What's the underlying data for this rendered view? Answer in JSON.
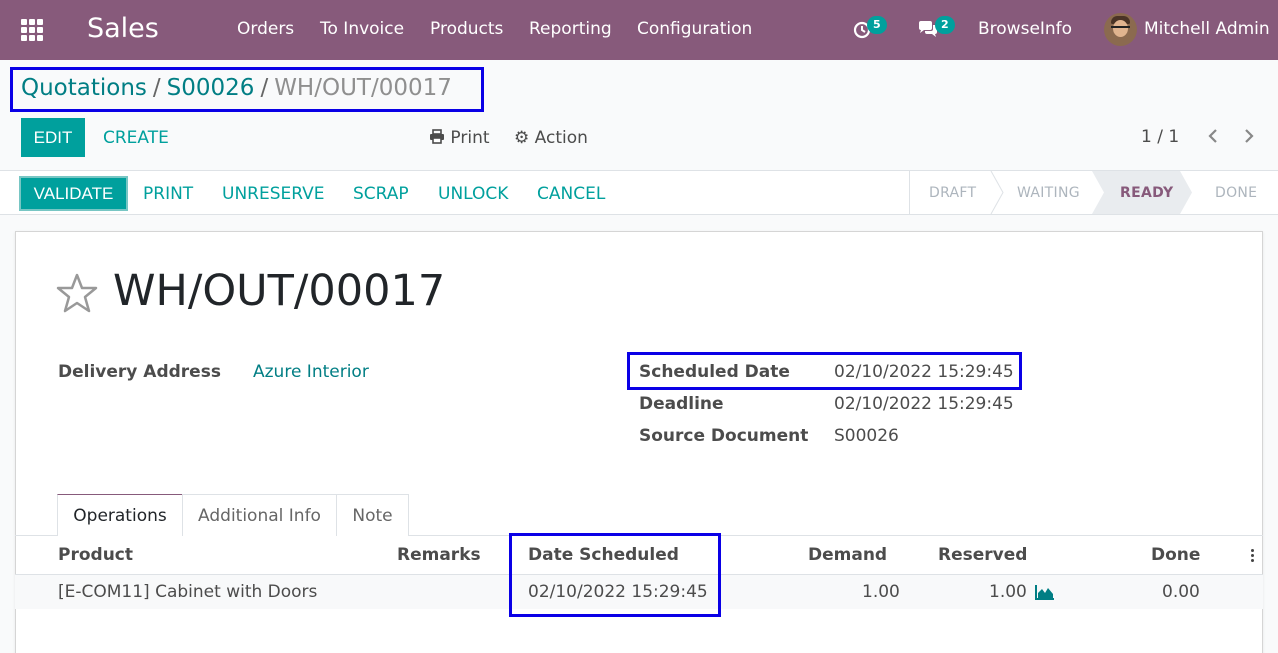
{
  "navbar": {
    "app_name": "Sales",
    "menu": [
      "Orders",
      "To Invoice",
      "Products",
      "Reporting",
      "Configuration"
    ],
    "activity_count": "5",
    "messages_count": "2",
    "company": "BrowseInfo",
    "user": "Mitchell Admin"
  },
  "breadcrumb": {
    "items": [
      "Quotations",
      "S00026"
    ],
    "separator": "/",
    "current": "WH/OUT/00017"
  },
  "control_panel": {
    "edit_label": "EDIT",
    "create_label": "CREATE",
    "print_label": "Print",
    "action_label": "Action",
    "pager": "1 / 1"
  },
  "header_buttons": {
    "validate": "VALIDATE",
    "print": "PRINT",
    "unreserve": "UNRESERVE",
    "scrap": "SCRAP",
    "unlock": "UNLOCK",
    "cancel": "CANCEL"
  },
  "status_steps": [
    "DRAFT",
    "WAITING",
    "READY",
    "DONE"
  ],
  "record": {
    "title": "WH/OUT/00017",
    "delivery_address_label": "Delivery Address",
    "delivery_address": "Azure Interior",
    "scheduled_date_label": "Scheduled Date",
    "scheduled_date": "02/10/2022 15:29:45",
    "deadline_label": "Deadline",
    "deadline": "02/10/2022 15:29:45",
    "source_document_label": "Source Document",
    "source_document": "S00026"
  },
  "tabs": [
    "Operations",
    "Additional Info",
    "Note"
  ],
  "table": {
    "columns": [
      "Product",
      "Remarks",
      "Date Scheduled",
      "Demand",
      "Reserved",
      "Done"
    ],
    "rows": [
      {
        "product": "[E-COM11] Cabinet with Doors",
        "remarks": "",
        "date_scheduled": "02/10/2022 15:29:45",
        "demand": "1.00",
        "reserved": "1.00",
        "done": "0.00"
      }
    ]
  },
  "colors": {
    "navbar": "#875a7b",
    "accent": "#00a09d",
    "link": "#017e84",
    "highlight_box": "#0a00e6"
  }
}
